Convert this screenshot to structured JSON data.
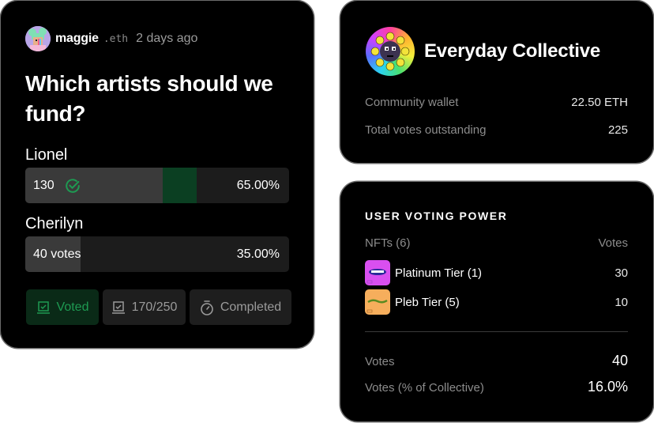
{
  "poll": {
    "author": {
      "name": "maggie",
      "ens_suffix": ".eth",
      "time": "2 days ago",
      "avatar_icon": "avatar-girl-icon"
    },
    "question": "Which artists should we fund?",
    "options": [
      {
        "label": "Lionel",
        "count_text": "130",
        "voted_by_user": true,
        "percent_text": "65.00%",
        "share": 0.65,
        "user_share": 0.13
      },
      {
        "label": "Cherilyn",
        "count_text": "40 votes",
        "voted_by_user": false,
        "percent_text": "35.00%",
        "share": 0.35
      }
    ],
    "chips": {
      "voted": {
        "label": "Voted",
        "icon": "ballot-box-icon"
      },
      "count": {
        "label": "170/250",
        "icon": "ballot-box-icon"
      },
      "status": {
        "label": "Completed",
        "icon": "stopwatch-icon"
      }
    },
    "colors": {
      "accent_green": "#1e9a52",
      "voted_fill": "#0b3f22",
      "bar_fill": "#3a3a3a",
      "bar_track": "#1c1c1c"
    }
  },
  "collective": {
    "name": "Everyday Collective",
    "logo_icon": "sunflower-logo-icon",
    "stats": [
      {
        "label": "Community wallet",
        "value": "22.50 ETH"
      },
      {
        "label": "Total votes outstanding",
        "value": "225"
      }
    ]
  },
  "voting_power": {
    "title": "USER VOTING POWER",
    "header": {
      "left": "NFTs (6)",
      "right": "Votes"
    },
    "nfts": [
      {
        "name": "Platinum Tier (1)",
        "votes": "30",
        "color": "#d94ff0"
      },
      {
        "name": "Pleb Tier (5)",
        "votes": "10",
        "color": "#f6ae5c"
      }
    ],
    "summary": [
      {
        "label": "Votes",
        "value": "40"
      },
      {
        "label": "Votes (% of Collective)",
        "value": "16.0%"
      }
    ]
  }
}
